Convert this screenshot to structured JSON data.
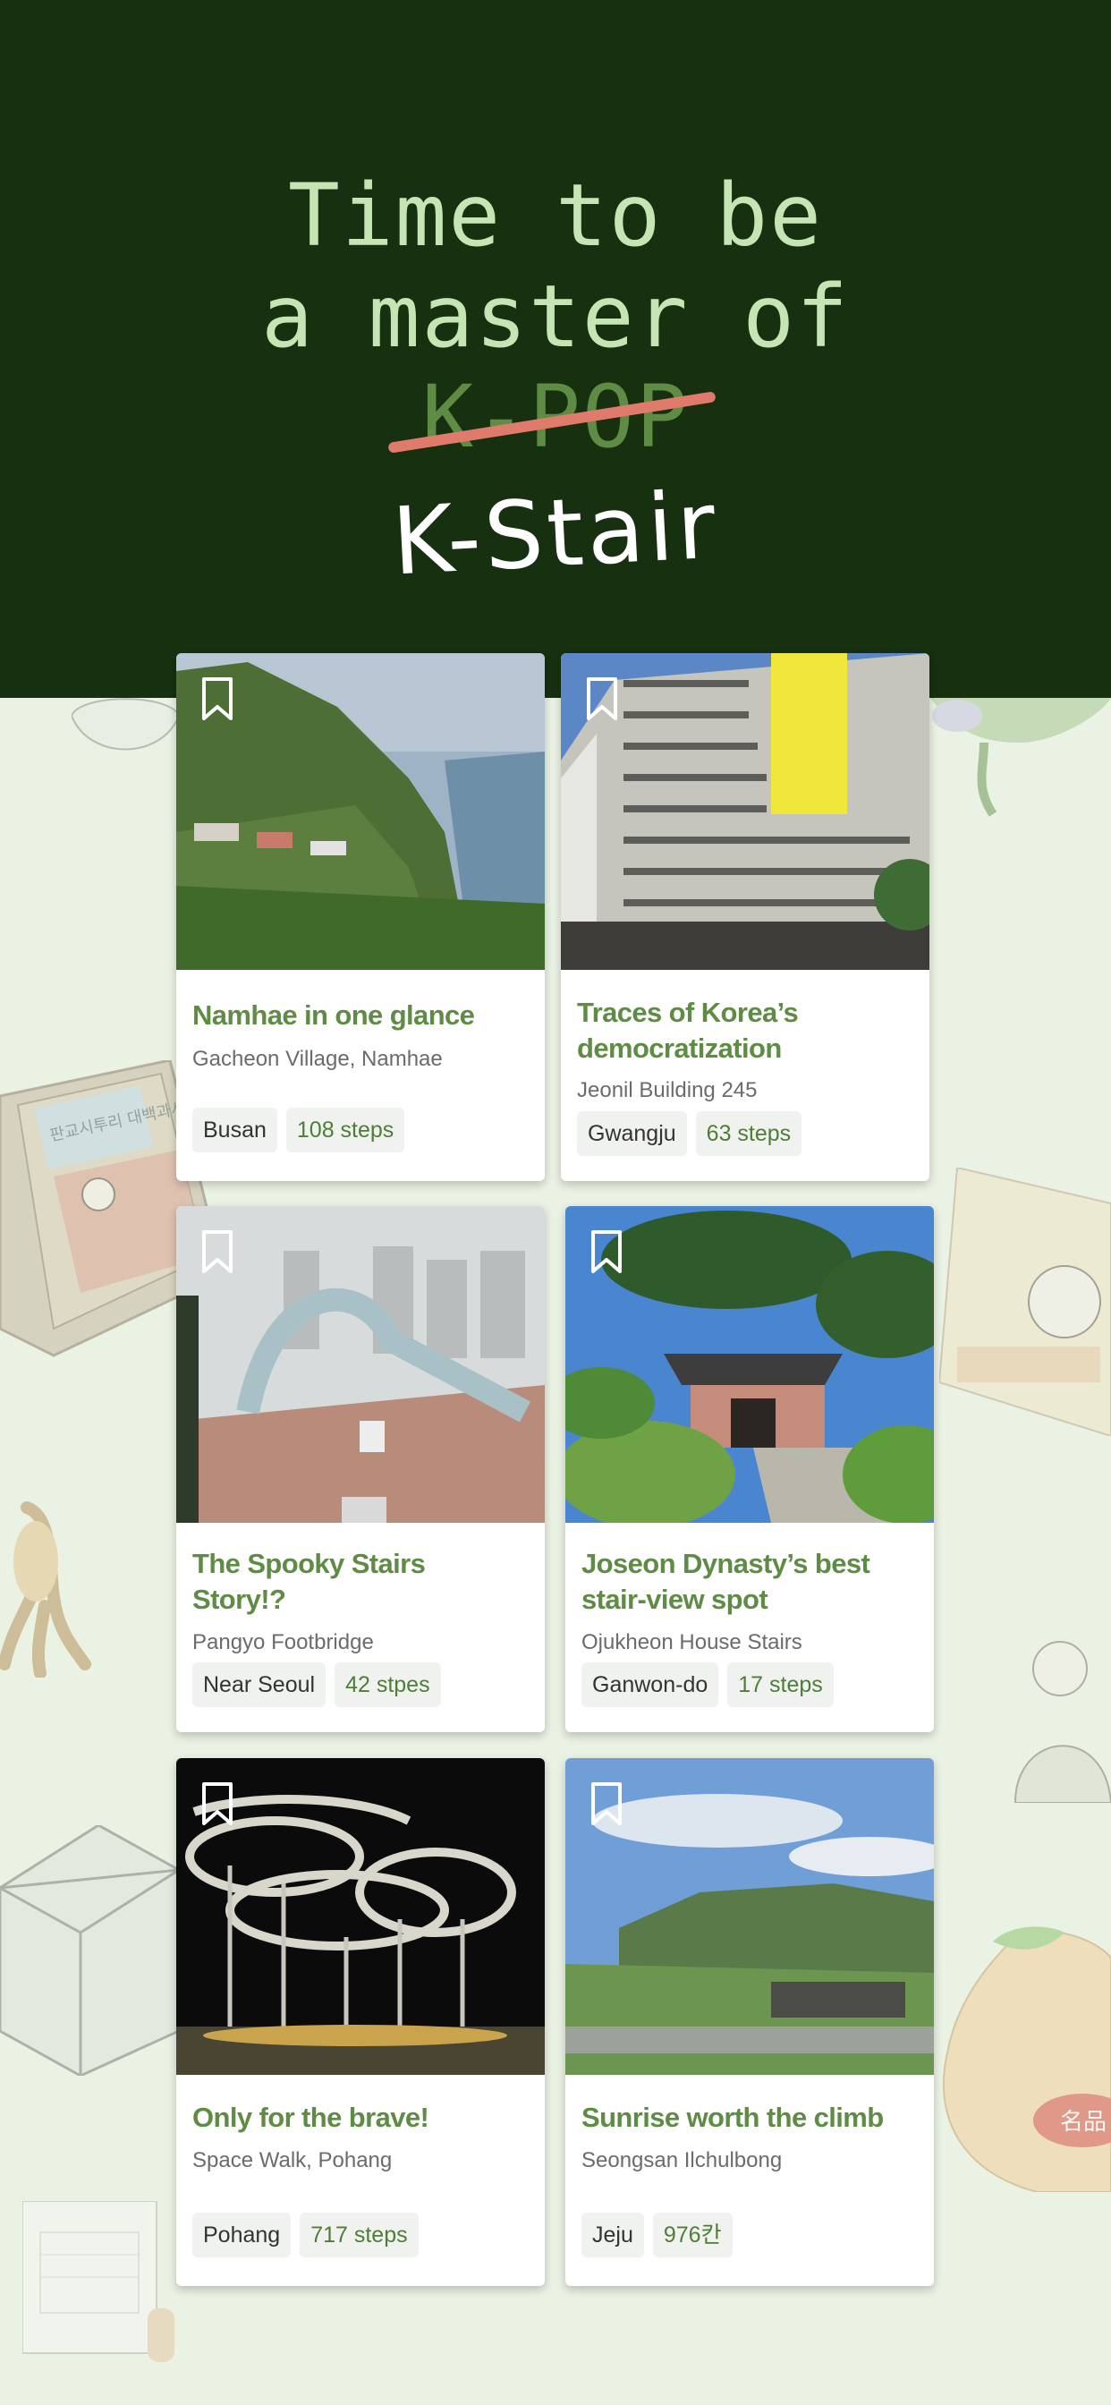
{
  "hero": {
    "line1": "Time to be",
    "line2": "a master of",
    "struck": "K-POP",
    "line4": "K-Stair"
  },
  "colors": {
    "hero_bg": "#163010",
    "page_bg": "#eaf2e4",
    "title_green": "#5e8c45",
    "strike_red": "#e07b6b"
  },
  "cards": [
    {
      "title_lines": [
        "Namhae in one glance"
      ],
      "subtitle": "Gacheon Village, Namhae",
      "region": "Busan",
      "steps": "108 steps"
    },
    {
      "title_lines": [
        "Traces of Korea’s",
        "democratization"
      ],
      "subtitle": "Jeonil Building 245",
      "region": "Gwangju",
      "steps": "63 steps"
    },
    {
      "title_lines": [
        "The Spooky Stairs",
        "Story!?"
      ],
      "subtitle": "Pangyo Footbridge",
      "region": "Near Seoul",
      "steps": "42 stpes"
    },
    {
      "title_lines": [
        "Joseon Dynasty’s best",
        "stair-view spot"
      ],
      "subtitle": "Ojukheon House Stairs",
      "region": "Ganwon-do",
      "steps": "17 steps"
    },
    {
      "title_lines": [
        "Only for the brave!"
      ],
      "subtitle": "Space Walk, Pohang",
      "region": "Pohang",
      "steps": "717 steps"
    },
    {
      "title_lines": [
        "Sunrise worth the climb"
      ],
      "subtitle": "Seongsan Ilchulbong",
      "region": "Jeju",
      "steps": "976칸"
    }
  ],
  "decorations": {
    "book_title": "판교시투리 대백과사전",
    "badge": "名品"
  },
  "icons": [
    "bookmark-icon"
  ]
}
